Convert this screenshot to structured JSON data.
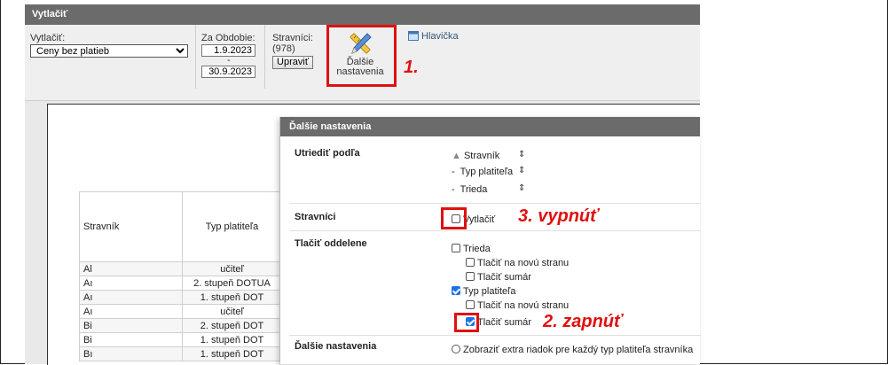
{
  "header": {
    "title": "Vytlačiť"
  },
  "toolbar": {
    "print_label": "Vytlačiť:",
    "print_selected": "Ceny bez platieb",
    "period_label": "Za Obdobie:",
    "date_from": "1.9.2023",
    "date_dash": "-",
    "date_to": "30.9.2023",
    "stravnici_label": "Stravníci:",
    "stravnici_count": "(978)",
    "upravit_label": "Upraviť",
    "dalsie_line1": "Ďalšie",
    "dalsie_line2": "nastavenia",
    "hlavicka_label": "Hlavička"
  },
  "annotations": {
    "a1": "1.",
    "a2": "2. zapnúť",
    "a3": "3. vypnúť",
    "color": "#e01010"
  },
  "report": {
    "columns": [
      "Stravník",
      "Typ platiteľa"
    ],
    "rows": [
      [
        "Al",
        "učiteľ"
      ],
      [
        "Aı",
        "2. stupeň DOTUA"
      ],
      [
        "Aı",
        "1. stupeň DOT"
      ],
      [
        "Aı",
        "učiteľ"
      ],
      [
        "Bi",
        "2. stupeň DOT"
      ],
      [
        "Bi",
        "1. stupeň DOT"
      ],
      [
        "Bı",
        "1. stupeň DOT"
      ]
    ]
  },
  "dialog": {
    "title": "Ďalšie nastavenia",
    "sort_label": "Utriediť podľa",
    "sort_items": [
      {
        "prefix": "▲",
        "label": "Stravník"
      },
      {
        "prefix": "-",
        "label": "Typ platiteľa"
      },
      {
        "prefix": "-",
        "label": "Trieda"
      }
    ],
    "stravnici_label": "Stravníci",
    "stravnici_option": "Vytlačiť",
    "tlacit_label": "Tlačiť oddelene",
    "trieda": "Trieda",
    "trieda_nova": "Tlačiť na novú stranu",
    "trieda_sumar": "Tlačiť sumár",
    "typ": "Typ platiteľa",
    "typ_nova": "Tlačiť na novú stranu",
    "typ_sumar": "Tlačiť sumár",
    "dalsie_label": "Ďalšie nastavenia",
    "dalsie_option": "Zobraziť extra riadok pre každý typ platiteľa stravníka"
  },
  "accent": "#1a73e8"
}
